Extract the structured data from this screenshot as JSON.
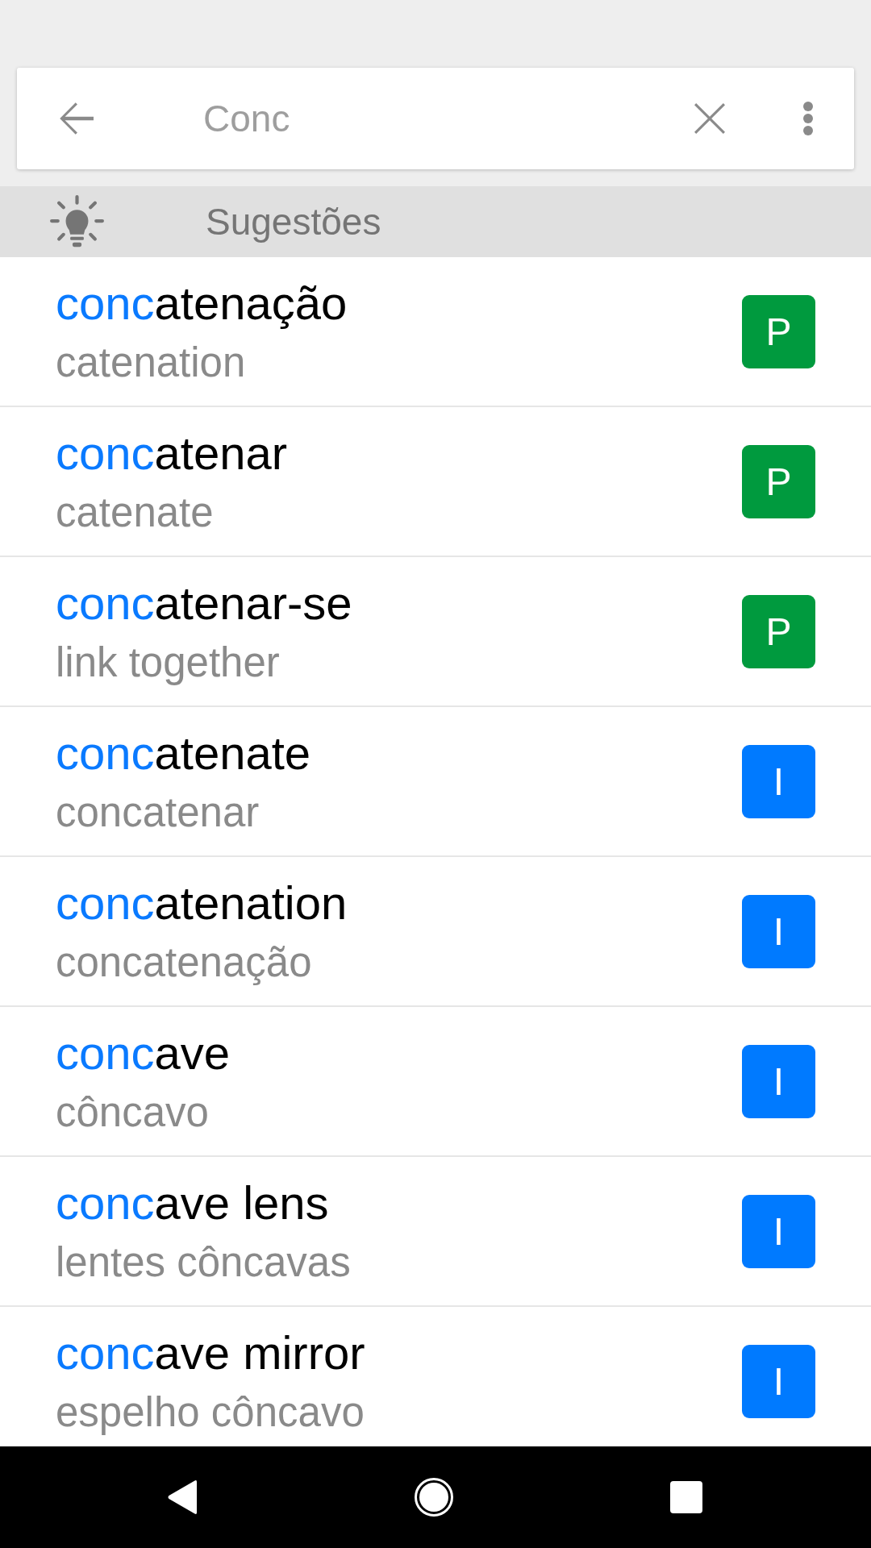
{
  "search": {
    "value": "Conc"
  },
  "suggestions_header": {
    "label": "Sugestões"
  },
  "results": [
    {
      "match": "conc",
      "rest": "atenação",
      "translation": "catenation",
      "badge": "P",
      "color": "#009a3e"
    },
    {
      "match": "conc",
      "rest": "atenar",
      "translation": "catenate",
      "badge": "P",
      "color": "#009a3e"
    },
    {
      "match": "conc",
      "rest": "atenar-se",
      "translation": "link together",
      "badge": "P",
      "color": "#009a3e"
    },
    {
      "match": "conc",
      "rest": "atenate",
      "translation": "concatenar",
      "badge": "I",
      "color": "#007aff"
    },
    {
      "match": "conc",
      "rest": "atenation",
      "translation": "concatenação",
      "badge": "I",
      "color": "#007aff"
    },
    {
      "match": "conc",
      "rest": "ave",
      "translation": "côncavo",
      "badge": "I",
      "color": "#007aff"
    },
    {
      "match": "conc",
      "rest": "ave lens",
      "translation": "lentes côncavas",
      "badge": "I",
      "color": "#007aff"
    },
    {
      "match": "conc",
      "rest": "ave mirror",
      "translation": "espelho côncavo",
      "badge": "I",
      "color": "#007aff"
    }
  ]
}
